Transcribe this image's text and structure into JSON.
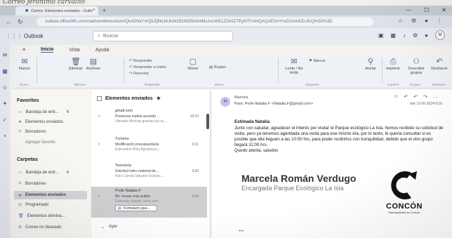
{
  "handwriting": "Correo jerónimo carvalho",
  "browser": {
    "tab_title": "Correo: Elementos enviados - Outlook",
    "url": "outlook.office365.com/mail/sentitems/id/AAQkADNkYmQ5ZjBkLWJmNDEtNDI5Ni04MzAxLWE1ZDk5ZTEyNTFmNQAQAE5mYmZ0cmVkZnJlcQ%3D%3D"
  },
  "outlook": {
    "brand": "Outlook",
    "search_placeholder": "Buscar",
    "menu_tabs": [
      "Inicio",
      "Vista",
      "Ayuda"
    ],
    "ribbon": {
      "nuevo": "Nuevo",
      "eliminar": "Eliminar",
      "archivar": "Archivar",
      "responder": "Responder",
      "responder_todos": "Responder a todos",
      "reenviar": "Reenviar",
      "mover": "Mover",
      "reglas": "Reglas",
      "leido": "Leído / No leído",
      "marcar": "Marcar",
      "anclar": "Anclar",
      "imprimir": "Imprimir",
      "descubrir": "Descubrir grupos",
      "deshacer": "Deshacer",
      "group_labels": [
        "Nuevo",
        "Eliminar",
        "Responder",
        "Mover",
        "Etiquetas",
        "Imprimir",
        "Grupos",
        "Deshacer"
      ]
    },
    "folders": {
      "favoritos": "Favoritos",
      "fav_items": [
        {
          "label": "Bandeja de entr...",
          "count": "4"
        },
        {
          "label": "Elementos enviados",
          "count": ""
        },
        {
          "label": "Borradores",
          "count": ""
        },
        {
          "label": "Agregar favorito",
          "count": ""
        }
      ],
      "carpetas": "Carpetas",
      "folder_items": [
        {
          "label": "Bandeja de entr...",
          "count": "4"
        },
        {
          "label": "Borradores",
          "count": ""
        },
        {
          "label": "Elementos enviados",
          "count": ""
        },
        {
          "label": "Programado",
          "count": ""
        },
        {
          "label": "Elementos elimina...",
          "count": ""
        },
        {
          "label": "Correo no deseado",
          "count": ""
        }
      ]
    },
    "list": {
      "title": "Elementos enviados",
      "messages": [
        {
          "from": "gmail.com",
          "subject": "Presencia maleta acuerdo ...",
          "preview": "Ubicado Muchas gracias por tu...",
          "time": "19:10"
        },
        {
          "from": "Turismo",
          "subject": "Modificación presupuestaria",
          "preview": "Estimados Hola Agradezco...",
          "time": "3:21"
        },
        {
          "from": "Tesorería",
          "subject": "Solicitud retiro material de...",
          "preview": "Para Carola Saludos Gracias...",
          "time": "3:20"
        },
        {
          "from": "Profe Natalia F",
          "subject": "Re: museo más pulido",
          "preview": "Estimada Natalia Junto con...",
          "time": "2:14"
        }
      ],
      "attachment": "Formulario gua...",
      "group_ayer": "Ayer"
    },
    "reading": {
      "from": "Marcela",
      "to": "Para: Profe Natalia F <Natalia.F@gmail.com>",
      "date": "mié 15-05-2024 8:16",
      "greeting": "Estimada Natalia:",
      "body": "Junto con saludar, agradecer el interés por visitar el Parque ecológico La Isla, hemos recibido su solicitud de visita, pero ya tenemos agendada una visita para ese mismo día, por lo tanto, le quería consultar si es posible que ella lleguen a las 10:00 hrs, para poder recibirlos con tranquilidad, debido que el otro grupo llegará 11:00 hrs.",
      "closing": "Quedo atenta, saludos",
      "sig_name": "Marcela Román Verdugo",
      "sig_role": "Encargada Parque Ecológico La Isla",
      "logo_text": "CONCÓN",
      "logo_sub": "Municipalidad de Concón"
    }
  }
}
